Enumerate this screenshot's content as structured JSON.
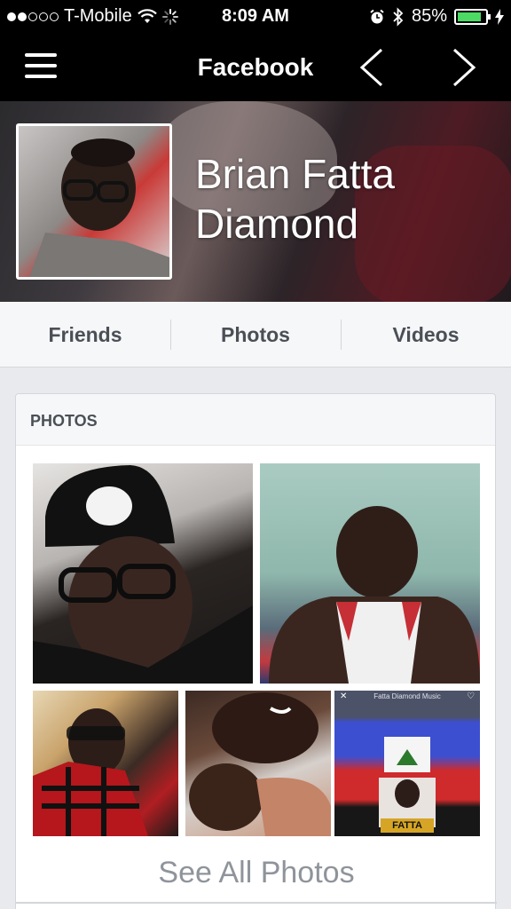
{
  "status_bar": {
    "carrier": "T-Mobile",
    "time": "8:09 AM",
    "battery": "85%",
    "battery_level": 0.85,
    "signal_bars": 2,
    "icons": [
      "wifi-icon",
      "activity-spinner-icon",
      "alarm-icon",
      "bluetooth-icon",
      "battery-icon",
      "charging-icon"
    ]
  },
  "navbar": {
    "title": "Facebook",
    "menu_icon": "hamburger-icon",
    "back_icon": "chevron-left-icon",
    "forward_icon": "chevron-right-icon"
  },
  "profile": {
    "name_line1": "Brian Fatta",
    "name_line2": "Diamond"
  },
  "tabs": [
    {
      "label": "Friends"
    },
    {
      "label": "Photos"
    },
    {
      "label": "Videos"
    }
  ],
  "photos_card": {
    "header": "PHOTOS",
    "see_all": "See All Photos",
    "music_app_title": "Fatta Diamond Music",
    "music_logo_text": "FATTA"
  },
  "colors": {
    "bar_background": "#000000",
    "page_background": "#e9eaed",
    "tab_text": "#4b4f56",
    "see_all_text": "#8f949b",
    "battery_fill": "#4cd964"
  }
}
